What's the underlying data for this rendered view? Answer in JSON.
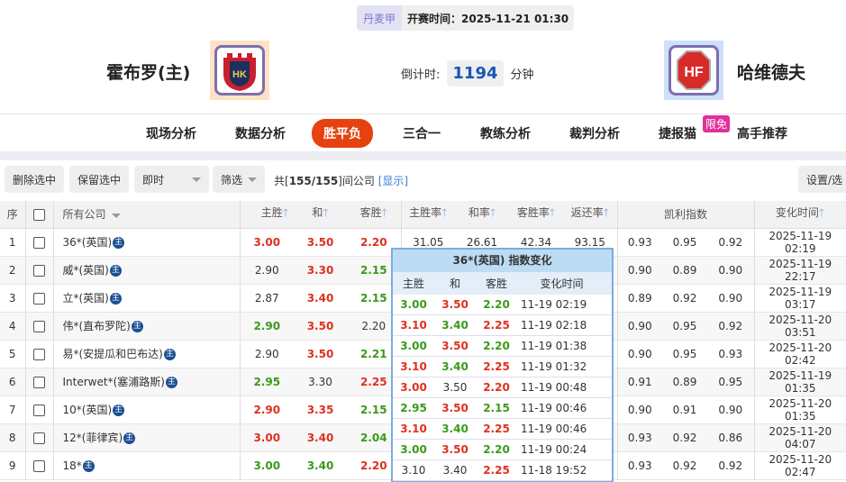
{
  "match": {
    "league": "丹麦甲",
    "kickoff": "开赛时间：2025-11-21 01:30",
    "home": "霍布罗(主)",
    "away": "哈维德夫",
    "home_logo_text": "HK",
    "away_logo_text": "HF",
    "countdown_label": "倒计时:",
    "countdown_value": "1194",
    "countdown_unit": "分钟"
  },
  "nav": {
    "items": [
      "现场分析",
      "数据分析",
      "胜平负",
      "三合一",
      "教练分析",
      "裁判分析",
      "捷报猫",
      "高手推荐"
    ],
    "active": "胜平负",
    "badge": "限免"
  },
  "toolbar": {
    "delete": "删除选中",
    "keep": "保留选中",
    "mode": "即时",
    "filter": "筛选",
    "summary_prefix": "共[",
    "summary_count": "155/155",
    "summary_suffix": "]间公司",
    "show": "[显示]",
    "settings": "设置/选"
  },
  "table": {
    "headers": {
      "idx": "序",
      "company": "所有公司",
      "home": "主胜",
      "draw": "和",
      "away": "客胜",
      "home_rate": "主胜率",
      "draw_rate": "和率",
      "away_rate": "客胜率",
      "return_rate": "返还率",
      "kelly": "凯利指数",
      "time": "变化时间"
    },
    "zhu_badge": "主",
    "colors": {
      "r": "#e0301e",
      "g": "#3a9a1a"
    },
    "rows": [
      {
        "idx": "1",
        "company": "36*(英国)",
        "odds": [
          {
            "v": "3.00",
            "c": "r"
          },
          {
            "v": "3.50",
            "c": "r"
          },
          {
            "v": "2.20",
            "c": "r"
          }
        ],
        "rates": [
          "31.05",
          "26.61",
          "42.34",
          "93.15"
        ],
        "kelly": [
          "0.93",
          "0.95",
          "0.92"
        ],
        "time": "2025-11-19 02:19"
      },
      {
        "idx": "2",
        "company": "威*(英国)",
        "odds": [
          {
            "v": "2.90",
            "c": ""
          },
          {
            "v": "3.30",
            "c": "r"
          },
          {
            "v": "2.15",
            "c": "g"
          }
        ],
        "kelly": [
          "0.90",
          "0.89",
          "0.90"
        ],
        "time": "2025-11-19 22:17"
      },
      {
        "idx": "3",
        "company": "立*(英国)",
        "odds": [
          {
            "v": "2.87",
            "c": ""
          },
          {
            "v": "3.40",
            "c": "r"
          },
          {
            "v": "2.15",
            "c": "g"
          }
        ],
        "kelly": [
          "0.89",
          "0.92",
          "0.90"
        ],
        "time": "2025-11-19 03:17"
      },
      {
        "idx": "4",
        "company": "伟*(直布罗陀)",
        "odds": [
          {
            "v": "2.90",
            "c": "g"
          },
          {
            "v": "3.50",
            "c": "r"
          },
          {
            "v": "2.20",
            "c": ""
          }
        ],
        "kelly": [
          "0.90",
          "0.95",
          "0.92"
        ],
        "time": "2025-11-20 03:51"
      },
      {
        "idx": "5",
        "company": "易*(安提瓜和巴布达)",
        "odds": [
          {
            "v": "2.90",
            "c": ""
          },
          {
            "v": "3.50",
            "c": "r"
          },
          {
            "v": "2.21",
            "c": "g"
          }
        ],
        "kelly": [
          "0.90",
          "0.95",
          "0.93"
        ],
        "time": "2025-11-20 02:42"
      },
      {
        "idx": "6",
        "company": "Interwet*(塞浦路斯)",
        "odds": [
          {
            "v": "2.95",
            "c": "g"
          },
          {
            "v": "3.30",
            "c": ""
          },
          {
            "v": "2.25",
            "c": "r"
          }
        ],
        "kelly": [
          "0.91",
          "0.89",
          "0.95"
        ],
        "time": "2025-11-19 01:35"
      },
      {
        "idx": "7",
        "company": "10*(英国)",
        "odds": [
          {
            "v": "2.90",
            "c": "r"
          },
          {
            "v": "3.35",
            "c": "r"
          },
          {
            "v": "2.15",
            "c": "g"
          }
        ],
        "kelly": [
          "0.90",
          "0.91",
          "0.90"
        ],
        "time": "2025-11-20 01:35"
      },
      {
        "idx": "8",
        "company": "12*(菲律宾)",
        "odds": [
          {
            "v": "3.00",
            "c": "r"
          },
          {
            "v": "3.40",
            "c": "r"
          },
          {
            "v": "2.04",
            "c": "g"
          }
        ],
        "kelly": [
          "0.93",
          "0.92",
          "0.86"
        ],
        "time": "2025-11-20 04:07"
      },
      {
        "idx": "9",
        "company": "18*",
        "odds": [
          {
            "v": "3.00",
            "c": "g"
          },
          {
            "v": "3.40",
            "c": "g"
          },
          {
            "v": "2.20",
            "c": "r"
          }
        ],
        "kelly": [
          "0.93",
          "0.92",
          "0.92"
        ],
        "time": "2025-11-20 02:47"
      }
    ]
  },
  "popup": {
    "title": "36*(英国) 指数变化",
    "headers": [
      "主胜",
      "和",
      "客胜",
      "变化时间"
    ],
    "rows": [
      [
        {
          "v": "3.00",
          "c": "g"
        },
        {
          "v": "3.50",
          "c": "r"
        },
        {
          "v": "2.20",
          "c": "g"
        },
        "11-19 02:19"
      ],
      [
        {
          "v": "3.10",
          "c": "r"
        },
        {
          "v": "3.40",
          "c": "g"
        },
        {
          "v": "2.25",
          "c": "r"
        },
        "11-19 02:18"
      ],
      [
        {
          "v": "3.00",
          "c": "g"
        },
        {
          "v": "3.50",
          "c": "r"
        },
        {
          "v": "2.20",
          "c": "g"
        },
        "11-19 01:38"
      ],
      [
        {
          "v": "3.10",
          "c": "r"
        },
        {
          "v": "3.40",
          "c": "g"
        },
        {
          "v": "2.25",
          "c": "r"
        },
        "11-19 01:32"
      ],
      [
        {
          "v": "3.00",
          "c": "r"
        },
        {
          "v": "3.50",
          "c": ""
        },
        {
          "v": "2.20",
          "c": "r"
        },
        "11-19 00:48"
      ],
      [
        {
          "v": "2.95",
          "c": "g"
        },
        {
          "v": "3.50",
          "c": "r"
        },
        {
          "v": "2.15",
          "c": "g"
        },
        "11-19 00:46"
      ],
      [
        {
          "v": "3.10",
          "c": "r"
        },
        {
          "v": "3.40",
          "c": "g"
        },
        {
          "v": "2.25",
          "c": "r"
        },
        "11-19 00:46"
      ],
      [
        {
          "v": "3.00",
          "c": "g"
        },
        {
          "v": "3.50",
          "c": "r"
        },
        {
          "v": "2.20",
          "c": "g"
        },
        "11-19 00:24"
      ],
      [
        {
          "v": "3.10",
          "c": ""
        },
        {
          "v": "3.40",
          "c": ""
        },
        {
          "v": "2.25",
          "c": "r"
        },
        "11-18 19:52"
      ]
    ]
  }
}
